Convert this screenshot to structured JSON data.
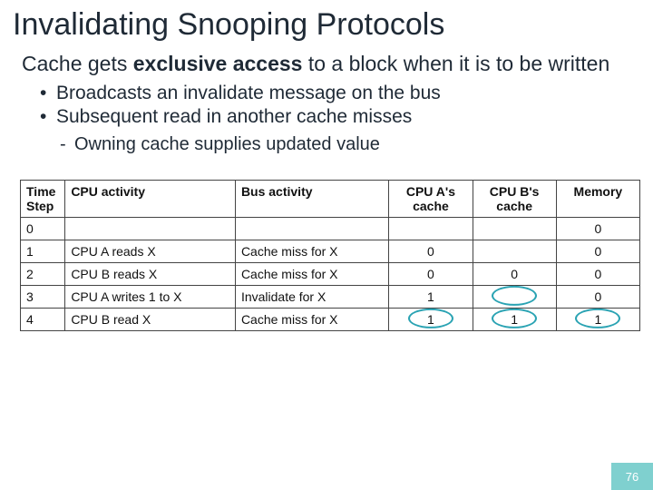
{
  "title": "Invalidating Snooping Protocols",
  "lead_pre": "Cache gets ",
  "lead_em": "exclusive access",
  "lead_post": " to a block when it is to be written",
  "bullets": {
    "b0": "Broadcasts an invalidate message on the bus",
    "b1": "Subsequent read in another cache misses",
    "b2": "Owning cache supplies updated value"
  },
  "table": {
    "head": {
      "c0": "Time Step",
      "c1": "CPU activity",
      "c2": "Bus activity",
      "c3": "CPU A's cache",
      "c4": "CPU B's cache",
      "c5": "Memory"
    },
    "rows": [
      {
        "c0": "0",
        "c1": "",
        "c2": "",
        "c3": "",
        "c4": "",
        "c5": "0"
      },
      {
        "c0": "1",
        "c1": "CPU A reads X",
        "c2": "Cache miss for X",
        "c3": "0",
        "c4": "",
        "c5": "0"
      },
      {
        "c0": "2",
        "c1": "CPU B reads X",
        "c2": "Cache miss for X",
        "c3": "0",
        "c4": "0",
        "c5": "0"
      },
      {
        "c0": "3",
        "c1": "CPU A writes 1 to X",
        "c2": "Invalidate for X",
        "c3": "1",
        "c4": "",
        "c5": "0"
      },
      {
        "c0": "4",
        "c1": "CPU B read X",
        "c2": "Cache miss for X",
        "c3": "1",
        "c4": "1",
        "c5": "1"
      }
    ]
  },
  "page_number": "76"
}
